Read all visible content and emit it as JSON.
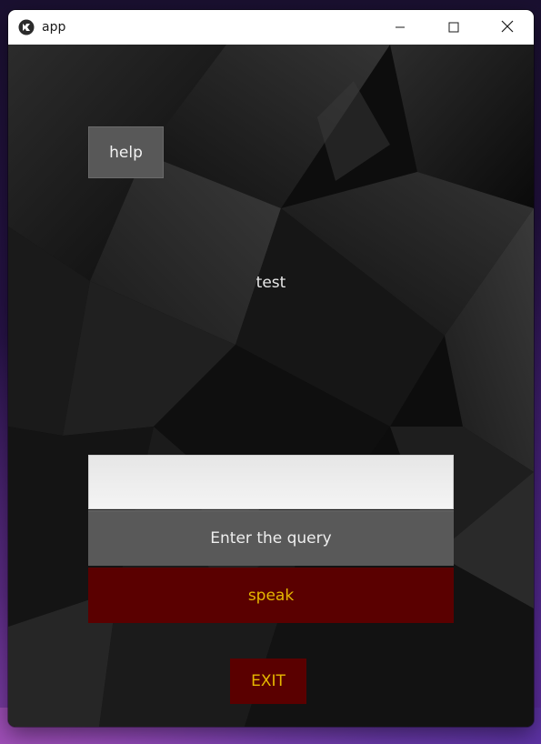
{
  "window": {
    "title": "app",
    "icon": "kivy-logo-icon",
    "controls": {
      "minimize_icon": "minimize-icon",
      "maximize_icon": "maximize-icon",
      "close_icon": "close-icon"
    }
  },
  "main": {
    "help_label": "help",
    "status_label": "test",
    "query_input": {
      "value": "",
      "placeholder": ""
    },
    "enter_label": "Enter the query",
    "speak_label": "speak",
    "exit_label": "EXIT"
  },
  "colors": {
    "button_gray": "#595959",
    "button_red": "#5a0000",
    "accent_text": "#e6b800",
    "background": "#0b0b0b"
  }
}
